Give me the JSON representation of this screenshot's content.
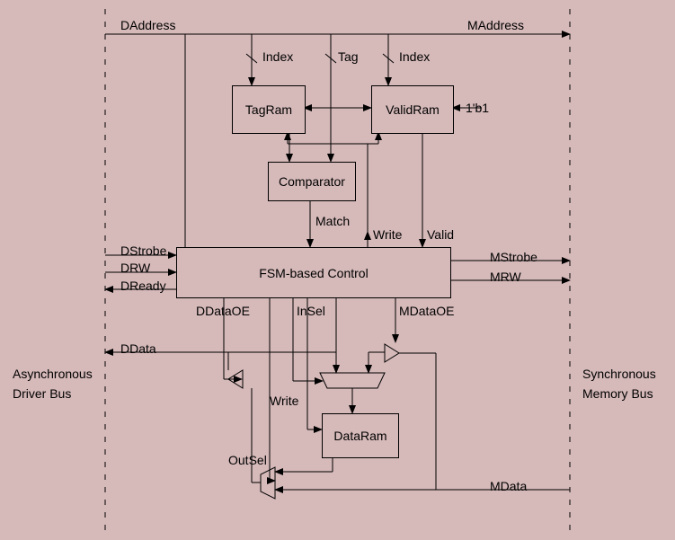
{
  "signals": {
    "daddress": "DAddress",
    "maddress": "MAddress",
    "index1": "Index",
    "tag": "Tag",
    "index2": "Index",
    "oneb1": "1'b1",
    "match": "Match",
    "write1": "Write",
    "valid": "Valid",
    "dstrobe": "DStrobe",
    "drw": "DRW",
    "dready": "DReady",
    "mstrobe": "MStrobe",
    "mrw": "MRW",
    "ddataoe": "DDataOE",
    "insel": "InSel",
    "mdataoe": "MDataOE",
    "ddata": "DData",
    "write2": "Write",
    "outsel": "OutSel",
    "mdata": "MData"
  },
  "blocks": {
    "tagram": "TagRam",
    "validram": "ValidRam",
    "comparator": "Comparator",
    "fsm": "FSM-based Control",
    "dataram": "DataRam"
  },
  "bus": {
    "left1": "Asynchronous",
    "left2": "Driver Bus",
    "right1": "Synchronous",
    "right2": "Memory Bus"
  }
}
